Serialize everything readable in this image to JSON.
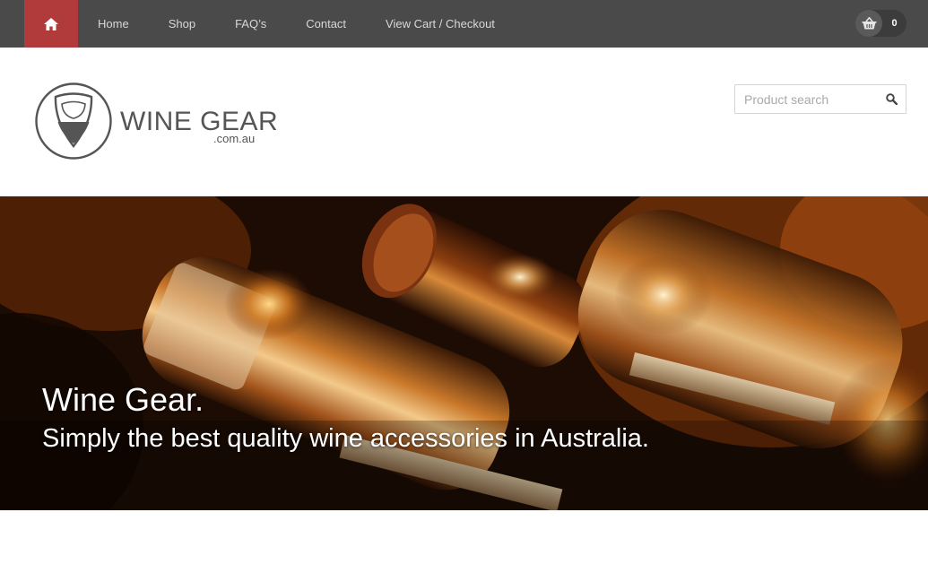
{
  "nav": {
    "home_icon": "home-icon",
    "items": [
      {
        "label": "Home"
      },
      {
        "label": "Shop"
      },
      {
        "label": "FAQ’s"
      },
      {
        "label": "Contact"
      },
      {
        "label": "View Cart / Checkout"
      }
    ],
    "cart": {
      "icon": "basket-icon",
      "count": "0"
    }
  },
  "header": {
    "logo": {
      "name": "WINE GEAR",
      "tld": ".com.au"
    },
    "search": {
      "placeholder": "Product search",
      "value": "",
      "icon": "search-icon"
    }
  },
  "hero": {
    "title": "Wine Gear.",
    "subtitle": "Simply the best quality wine accessories in Australia."
  },
  "colors": {
    "topbar": "#4a4a4a",
    "accent": "#b13b3b",
    "logo_text": "#555555"
  }
}
